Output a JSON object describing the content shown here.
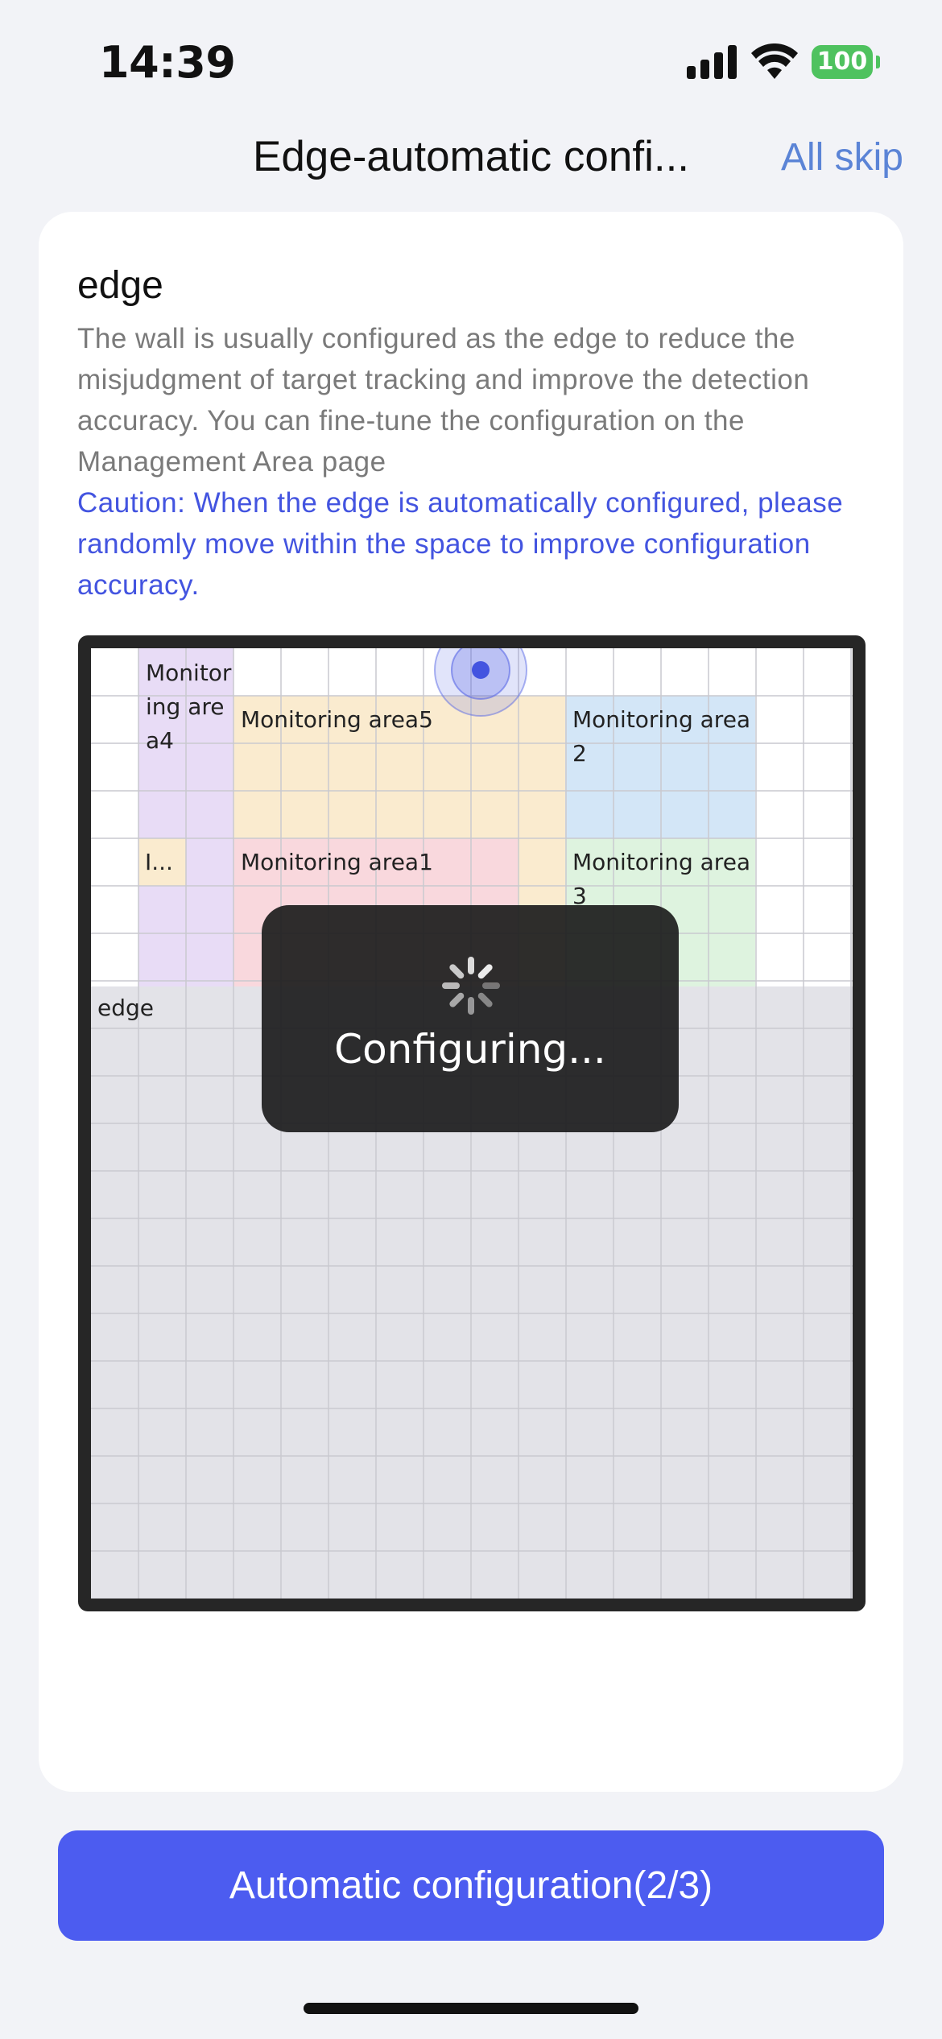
{
  "status_bar": {
    "time": "14:39",
    "battery": "100",
    "icons": [
      "cellular-signal-icon",
      "wifi-icon",
      "battery-icon"
    ]
  },
  "nav": {
    "title": "Edge-automatic confi...",
    "skip_label": "All skip"
  },
  "card": {
    "title": "edge",
    "description": "The wall is usually configured as the edge to reduce the misjudgment of target tracking and improve the detection accuracy. You can fine-tune the configuration on the Management Area page",
    "caution": "Caution: When the edge is automatically configured, please randomly move within the space to improve configuration accuracy."
  },
  "map": {
    "zones": {
      "area4": "Monitoring area4",
      "area5": "Monitoring area5",
      "area2": "Monitoring area2",
      "area1": "Monitoring area1",
      "area3": "Monitoring area3",
      "small": "I...",
      "edge": "edge"
    },
    "colors": {
      "area4": "#e8dcf6",
      "area5": "#faebcf",
      "area2": "#d3e6f7",
      "area1": "#f9d8dd",
      "area3": "#def3df",
      "edge": "#e3e3e8",
      "sensor": "#5868e6"
    }
  },
  "loading": {
    "text": "Configuring..."
  },
  "cta": {
    "label": "Automatic configuration(2/3)"
  }
}
